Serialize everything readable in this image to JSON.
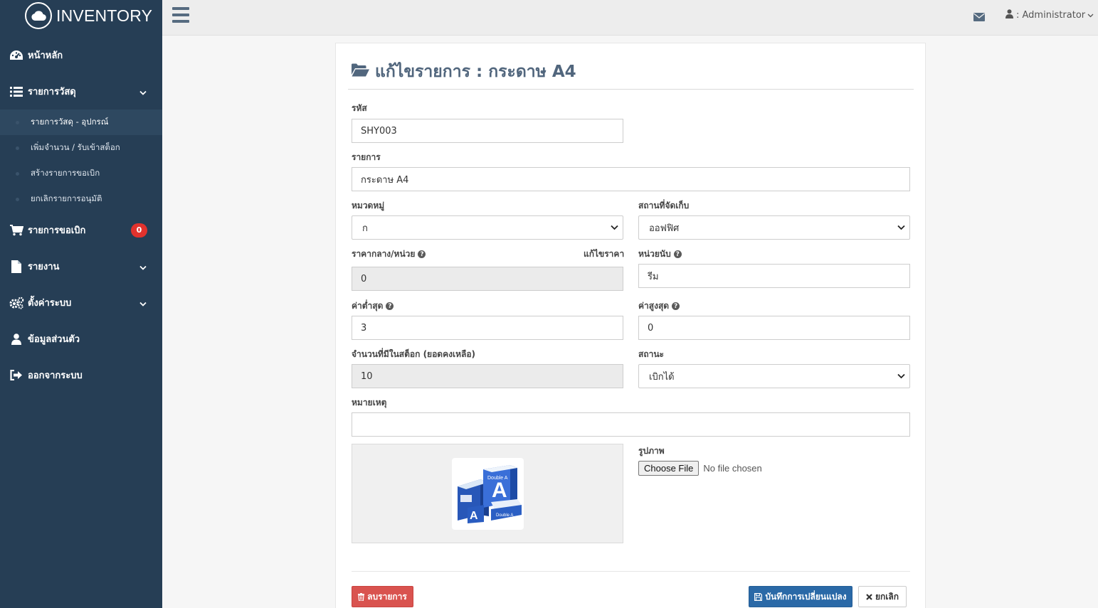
{
  "brand": {
    "name": "INVENTORY",
    "icon": "cloud-icon"
  },
  "sidebar": {
    "items": [
      {
        "label": "หน้าหลัก",
        "icon": "dashboard-icon"
      },
      {
        "label": "รายการวัสดุ",
        "icon": "list-icon",
        "expanded": true,
        "children": [
          {
            "label": "รายการวัสดุ - อุปกรณ์",
            "active": true
          },
          {
            "label": "เพิ่มจำนวน / รับเข้าสต็อก"
          },
          {
            "label": "สร้างรายการขอเบิก"
          },
          {
            "label": "ยกเลิกรายการอนุมัติ"
          }
        ]
      },
      {
        "label": "รายการขอเบิก",
        "icon": "cart-icon",
        "badge": "0"
      },
      {
        "label": "รายงาน",
        "icon": "file-icon"
      },
      {
        "label": "ตั้งค่าระบบ",
        "icon": "gears-icon"
      },
      {
        "label": "ข้อมูลส่วนตัว",
        "icon": "user-icon"
      },
      {
        "label": "ออกจากระบบ",
        "icon": "sign-out-icon"
      }
    ]
  },
  "topbar": {
    "user_label": ": Administrator"
  },
  "page": {
    "title": "แก้ไขรายการ : กระดาษ A4"
  },
  "form": {
    "code": {
      "label": "รหัส",
      "value": "SHY003"
    },
    "item": {
      "label": "รายการ",
      "value": "กระดาษ A4"
    },
    "category": {
      "label": "หมวดหมู่",
      "value": "ก"
    },
    "storage": {
      "label": "สถานที่จัดเก็บ",
      "value": "ออฟฟิศ"
    },
    "price": {
      "label": "ราคากลาง/หน่วย",
      "value": "0",
      "edit_label": "แก้ไขราคา"
    },
    "unit": {
      "label": "หน่วยนับ",
      "value": "รีม"
    },
    "min": {
      "label": "ค่าต่ำสุด",
      "value": "3"
    },
    "max": {
      "label": "ค่าสูงสุด",
      "value": "0"
    },
    "stock": {
      "label": "จำนวนที่มีในสต็อก (ยอดคงเหลือ)",
      "value": "10"
    },
    "status": {
      "label": "สถานะ",
      "value": "เบิกได้"
    },
    "note": {
      "label": "หมายเหตุ",
      "value": ""
    },
    "image": {
      "label": "รูปภาพ",
      "button": "Choose File",
      "status": "No file chosen"
    }
  },
  "buttons": {
    "delete": "ลบรายการ",
    "save": "บันทึกการเปลี่ยนแปลง",
    "cancel": "ยกเลิก"
  },
  "colors": {
    "sidebar_bg": "#263e55",
    "primary": "#2a69a7",
    "danger": "#d9534f",
    "badge": "#e2322d",
    "title": "#51667d"
  }
}
